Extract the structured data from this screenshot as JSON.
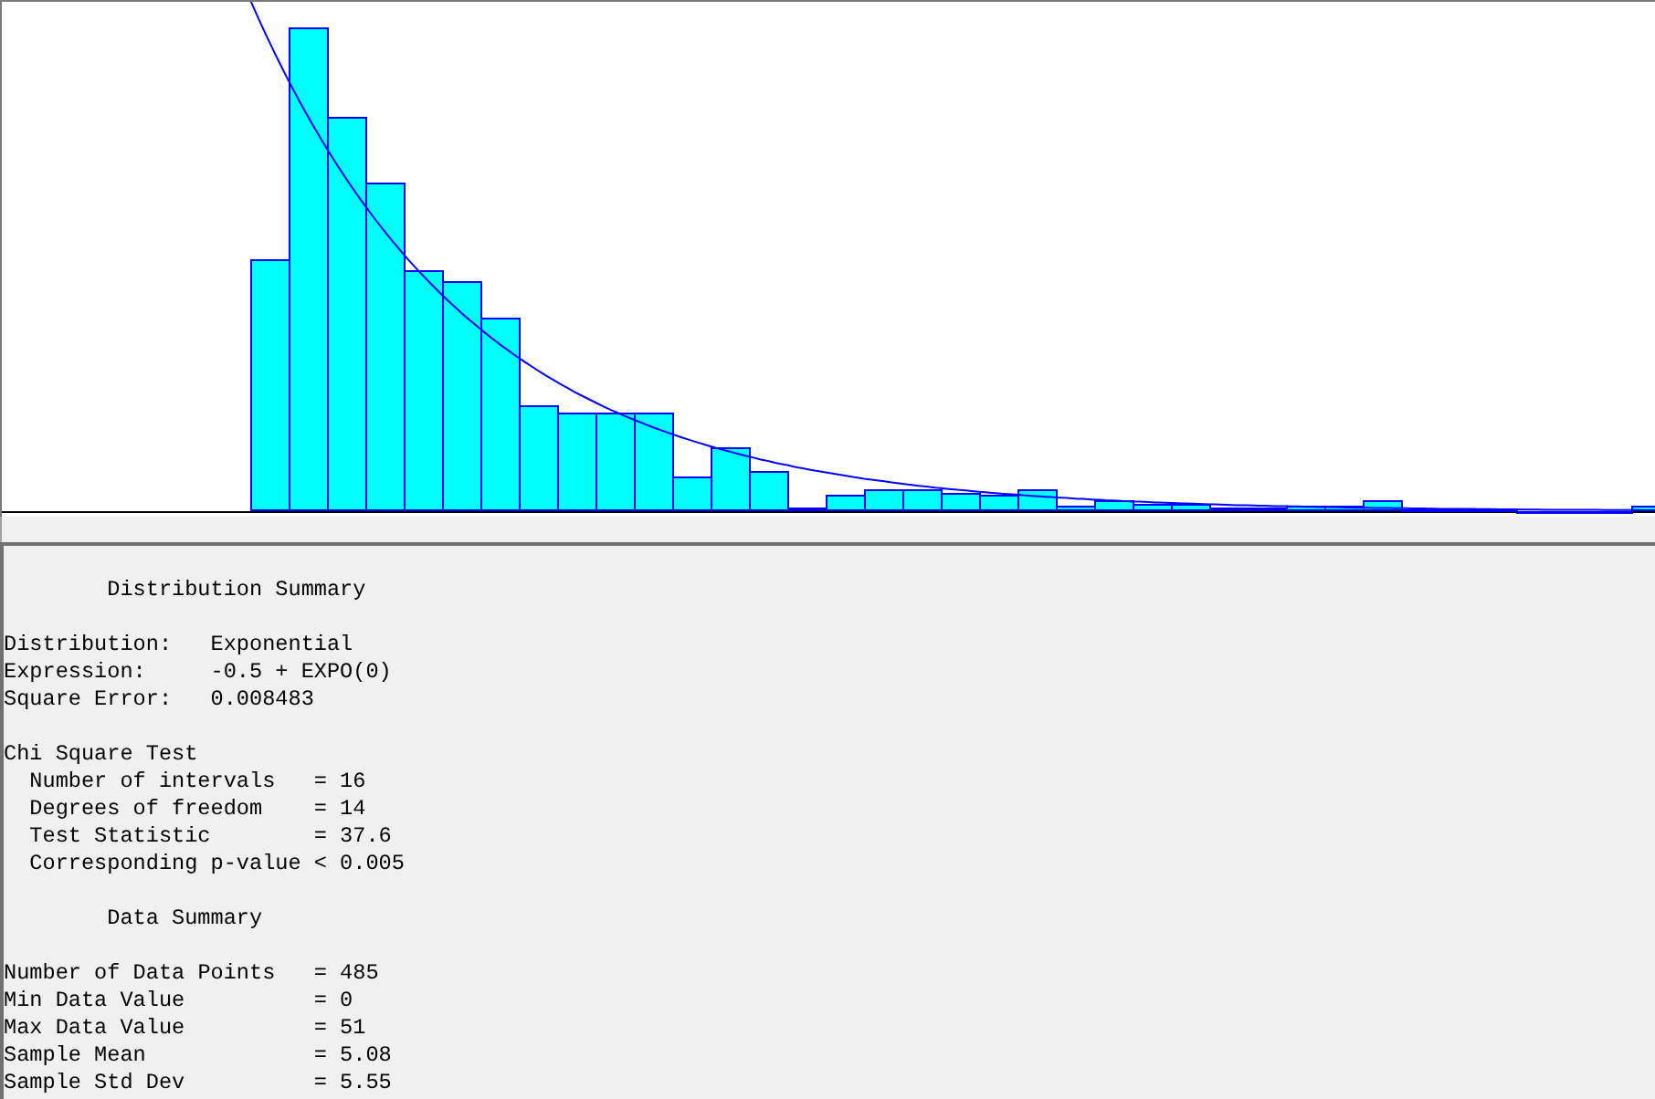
{
  "distribution_summary": {
    "title": "Distribution Summary",
    "fit": [
      {
        "label": "Distribution:",
        "value": "Exponential"
      },
      {
        "label": "Expression:",
        "value": "-0.5 + EXPO(0)"
      },
      {
        "label": "Square Error:",
        "value": "0.008483"
      }
    ],
    "chi_square_test": {
      "title": "Chi Square Test",
      "rows": [
        {
          "label": "Number of intervals",
          "value": "= 16"
        },
        {
          "label": "Degrees of freedom",
          "value": "= 14"
        },
        {
          "label": "Test Statistic",
          "value": "= 37.6"
        },
        {
          "label": "Corresponding p-value",
          "value": "< 0.005"
        }
      ]
    }
  },
  "data_summary": {
    "title": "Data Summary",
    "rows": [
      {
        "label": "Number of Data Points",
        "value": "= 485"
      },
      {
        "label": "Min Data Value",
        "value": "= 0"
      },
      {
        "label": "Max Data Value",
        "value": "= 51"
      },
      {
        "label": "Sample Mean",
        "value": "= 5.08"
      },
      {
        "label": "Sample Std Dev",
        "value": "= 5.55"
      }
    ]
  }
}
